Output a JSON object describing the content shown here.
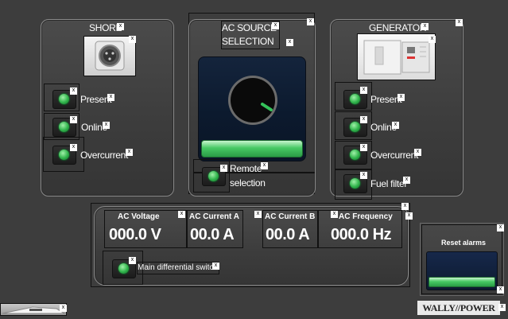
{
  "shore": {
    "title": "SHORE",
    "indicators": [
      "Present",
      "Online",
      "Overcurrent"
    ]
  },
  "ac_source": {
    "title_line1": "AC SOURCE",
    "title_line2": "SELECTION",
    "remote_line1": "Remote",
    "remote_line2": "selection"
  },
  "generator": {
    "title": "GENERATOR",
    "indicators": [
      "Present",
      "Online",
      "Overcurrent",
      "Fuel filter"
    ]
  },
  "measurements": {
    "ac_voltage_label": "AC Voltage",
    "ac_voltage_value": "000.0 V",
    "ac_current_a_label": "AC Current A",
    "ac_current_a_value": "00.0 A",
    "ac_current_b_label": "AC Current B",
    "ac_current_b_value": "00.0 A",
    "ac_frequency_label": "AC Frequency",
    "ac_frequency_value": "000.0 Hz",
    "main_switch_label": "Main differential switc"
  },
  "reset": {
    "label": "Reset alarms"
  },
  "brand": {
    "logo": "WALLY//POWER"
  },
  "close_glyph": "x",
  "colors": {
    "background": "#3d3d3d",
    "led_green": "#2fb34a",
    "button_green": "#3fbf5a"
  }
}
